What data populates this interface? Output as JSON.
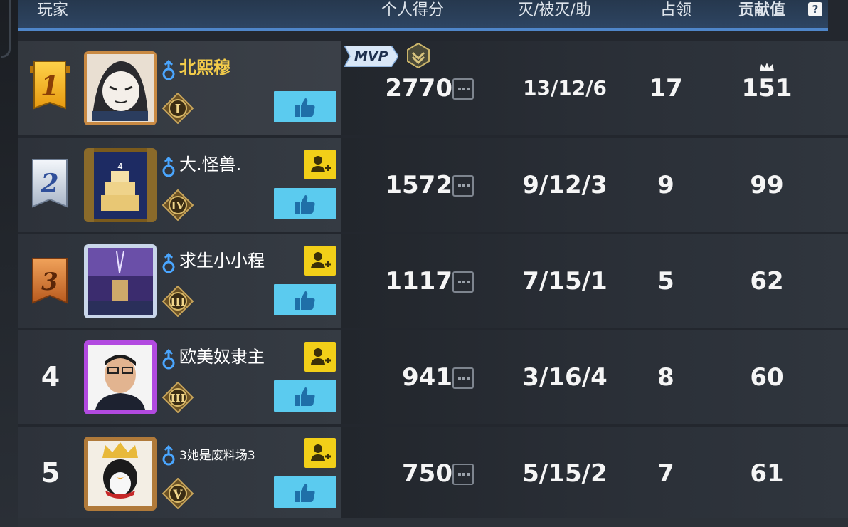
{
  "header": {
    "player": "玩家",
    "score": "个人得分",
    "kda": "灭/被灭/助",
    "occupy": "占领",
    "contribution": "贡献值",
    "help_icon": "?"
  },
  "mvp": {
    "label": "MVP"
  },
  "colors": {
    "header_bg": "#2e4562",
    "header_line": "#4f86c9",
    "gold_name": "#f3cc4a",
    "add_friend": "#f2cf18",
    "like": "#5bcbef"
  },
  "players": [
    {
      "rank": "1",
      "name": "北熙穆",
      "tier": "I",
      "score": "2770",
      "kda": "13/12/6",
      "occupy": "17",
      "contribution": "151"
    },
    {
      "rank": "2",
      "name": "大.怪兽.",
      "tier": "IV",
      "score": "1572",
      "kda": "9/12/3",
      "occupy": "9",
      "contribution": "99"
    },
    {
      "rank": "3",
      "name": "求生小小程",
      "tier": "III",
      "score": "1117",
      "kda": "7/15/1",
      "occupy": "5",
      "contribution": "62"
    },
    {
      "rank": "4",
      "name": "欧美奴隶主",
      "tier": "III",
      "score": "941",
      "kda": "3/16/4",
      "occupy": "8",
      "contribution": "60"
    },
    {
      "rank": "5",
      "name": "3她是废料场3",
      "tier": "V",
      "score": "750",
      "kda": "5/15/2",
      "occupy": "7",
      "contribution": "61"
    }
  ]
}
